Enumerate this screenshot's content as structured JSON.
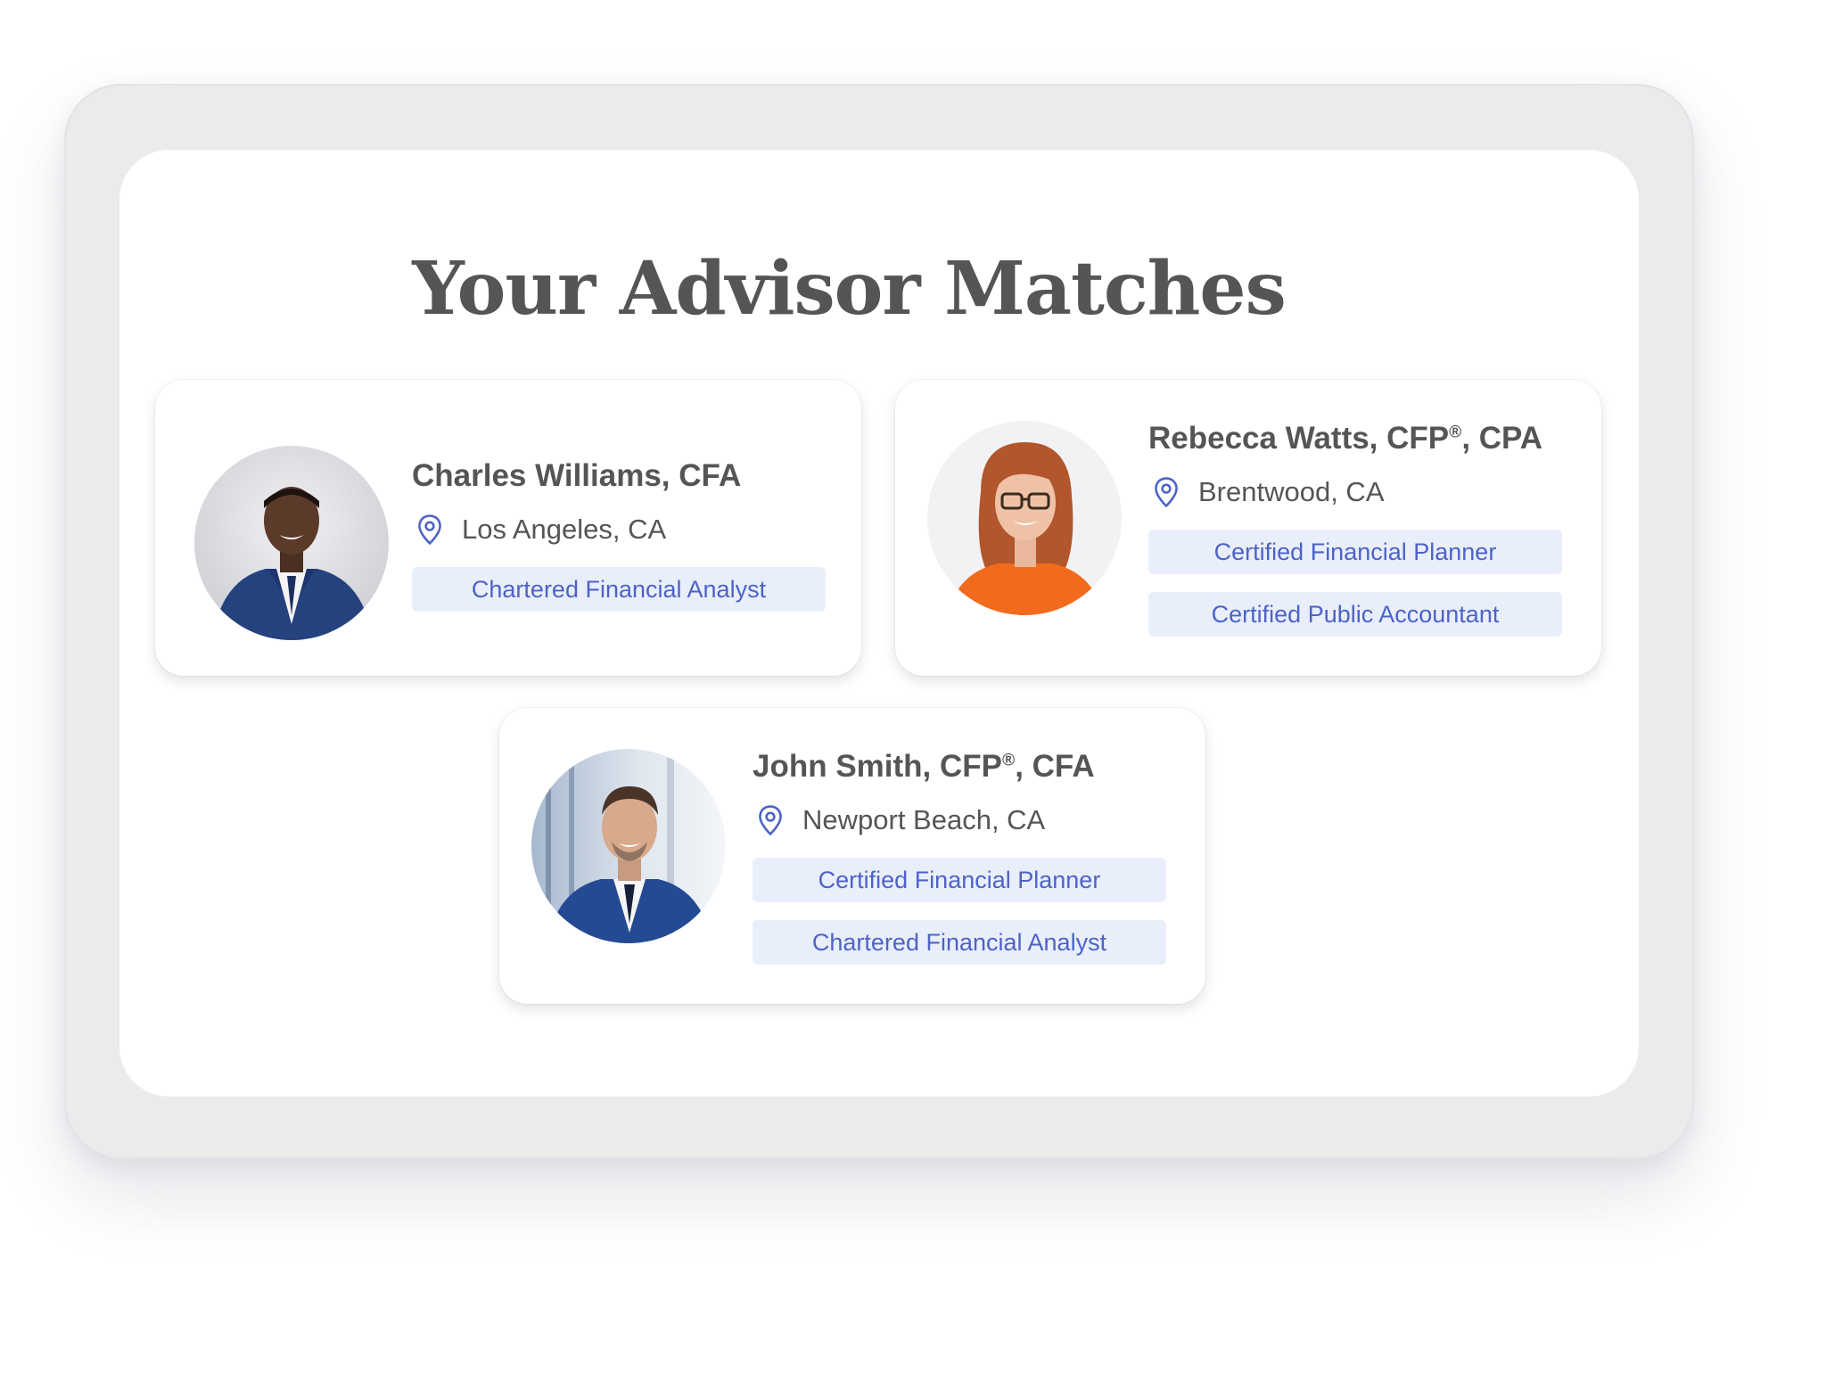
{
  "title": "Your Advisor Matches",
  "advisors": [
    {
      "name": "Charles Williams, CFA",
      "location": "Los Angeles, CA",
      "credentials": [
        "Chartered Financial Analyst"
      ]
    },
    {
      "name_prefix": "Rebecca Watts, CFP",
      "name_mark": "®",
      "name_suffix": ", CPA",
      "location": "Brentwood, CA",
      "credentials": [
        "Certified Financial Planner",
        "Certified Public Accountant"
      ]
    },
    {
      "name_prefix": "John Smith, CFP",
      "name_mark": "®",
      "name_suffix": ", CFA",
      "location": "Newport Beach, CA",
      "credentials": [
        "Certified Financial Planner",
        "Chartered Financial Analyst"
      ]
    }
  ],
  "icons": {
    "location": "map-pin-icon"
  },
  "colors": {
    "title_text": "#555555",
    "tag_background": "#e9eefb",
    "tag_text": "#4d63c6",
    "pin": "#4d63c6",
    "frame": "#ebebeb"
  }
}
